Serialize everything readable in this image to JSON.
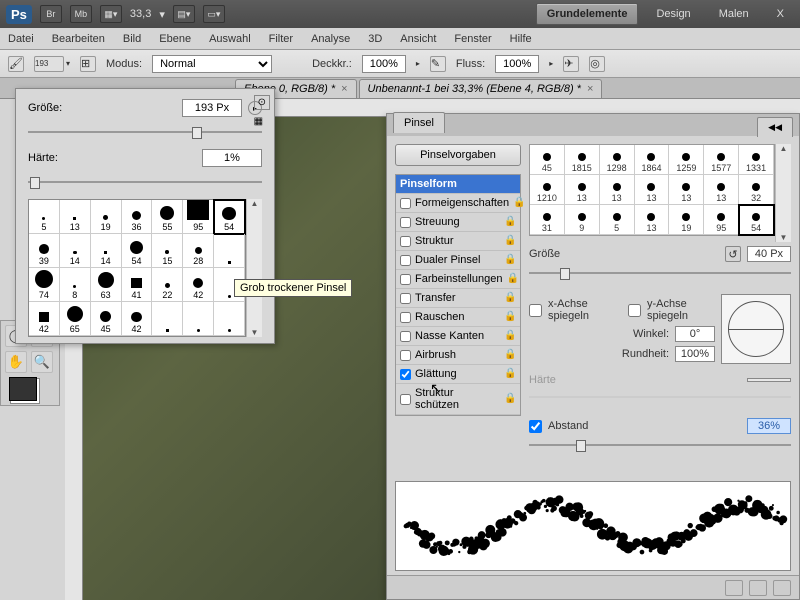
{
  "topbar": {
    "ps": "Ps",
    "br": "Br",
    "mb": "Mb",
    "zoom": "33,3",
    "btn_grund": "Grundelemente",
    "btn_design": "Design",
    "btn_malen": "Malen",
    "btn_x": "X"
  },
  "menu": [
    "Datei",
    "Bearbeiten",
    "Bild",
    "Ebene",
    "Auswahl",
    "Filter",
    "Analyse",
    "3D",
    "Ansicht",
    "Fenster",
    "Hilfe"
  ],
  "optbar": {
    "brush_size": "193",
    "modus_label": "Modus:",
    "modus_value": "Normal",
    "deckkr_label": "Deckkr.:",
    "deckkr_value": "100%",
    "fluss_label": "Fluss:",
    "fluss_value": "100%"
  },
  "tabs": {
    "t1": "Ebene 0, RGB/8) *",
    "t2": "Unbenannt-1 bei 33,3% (Ebene 4, RGB/8) *"
  },
  "brush_popup": {
    "size_label": "Größe:",
    "size_value": "193 Px",
    "hardness_label": "Härte:",
    "hardness_value": "1%",
    "tooltip": "Grob trockener Pinsel",
    "cells": [
      "5",
      "13",
      "19",
      "36",
      "55",
      "95",
      "54",
      "39",
      "14",
      "14",
      "54",
      "15",
      "28",
      "",
      "74",
      "8",
      "63",
      "41",
      "22",
      "42",
      "",
      "42",
      "65",
      "45",
      "42",
      "",
      "",
      ""
    ]
  },
  "pinsel": {
    "tab": "Pinsel",
    "preset_btn": "Pinselvorgaben",
    "header": "Pinselform",
    "options": [
      "Formeigenschaften",
      "Streuung",
      "Struktur",
      "Dualer Pinsel",
      "Farbeinstellungen",
      "Transfer",
      "Rauschen",
      "Nasse Kanten",
      "Airbrush",
      "Glättung",
      "Struktur schützen"
    ],
    "thumbs": [
      "45",
      "1815",
      "1298",
      "1864",
      "1259",
      "1577",
      "1331",
      "1210",
      "13",
      "13",
      "13",
      "13",
      "13",
      "32",
      "31",
      "9",
      "5",
      "13",
      "19",
      "95",
      "54"
    ],
    "size_label": "Größe",
    "size_value": "40 Px",
    "flipx": "x-Achse spiegeln",
    "flipy": "y-Achse spiegeln",
    "angle_label": "Winkel:",
    "angle_value": "0°",
    "round_label": "Rundheit:",
    "round_value": "100%",
    "haerte_label": "Härte",
    "abstand_label": "Abstand",
    "abstand_value": "36%"
  }
}
